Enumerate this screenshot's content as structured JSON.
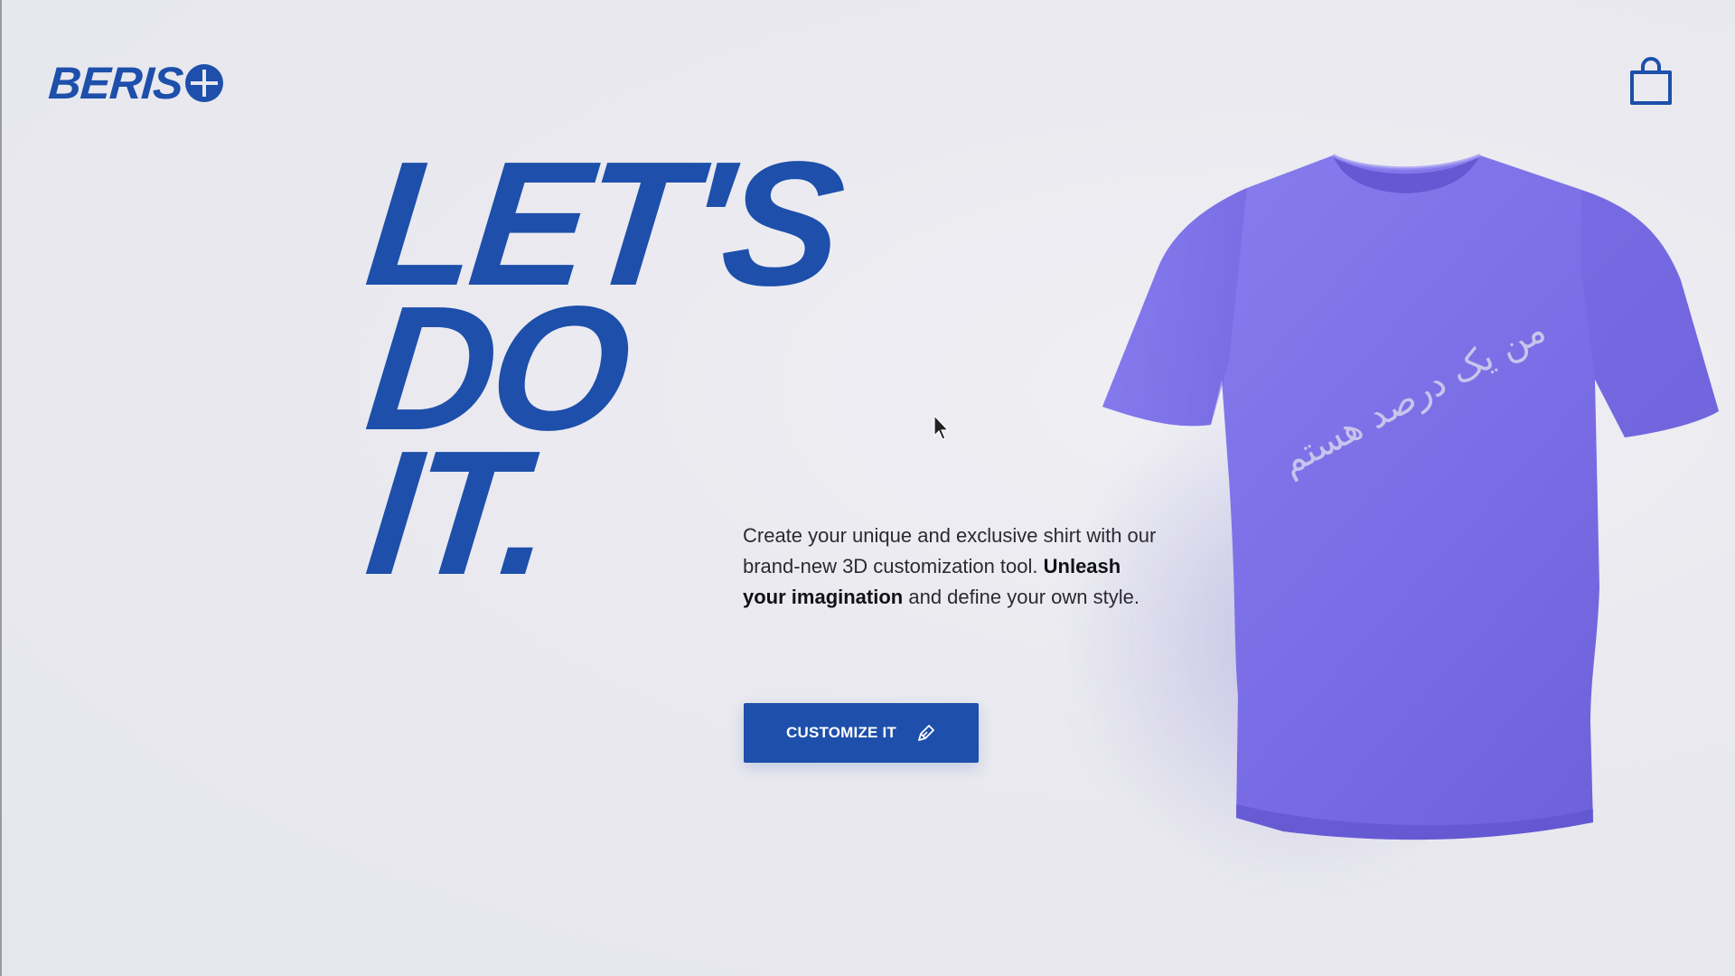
{
  "brand": {
    "name": "BERIS",
    "accent_color": "#1d4fab"
  },
  "header": {
    "cart_icon": "shopping-bag-icon"
  },
  "hero": {
    "headline_lines": [
      "LET'S",
      "DO",
      "IT."
    ],
    "description_part1": "Create your unique and exclusive shirt with our brand-new 3D customization tool.",
    "description_bold": "Unleash your imagination",
    "description_part2": " and define your own style.",
    "cta_label": "CUSTOMIZE IT",
    "cta_icon": "brush-icon"
  },
  "product": {
    "shirt_color": "#7b6ee6",
    "print_text": "من یک درصد هستم"
  }
}
